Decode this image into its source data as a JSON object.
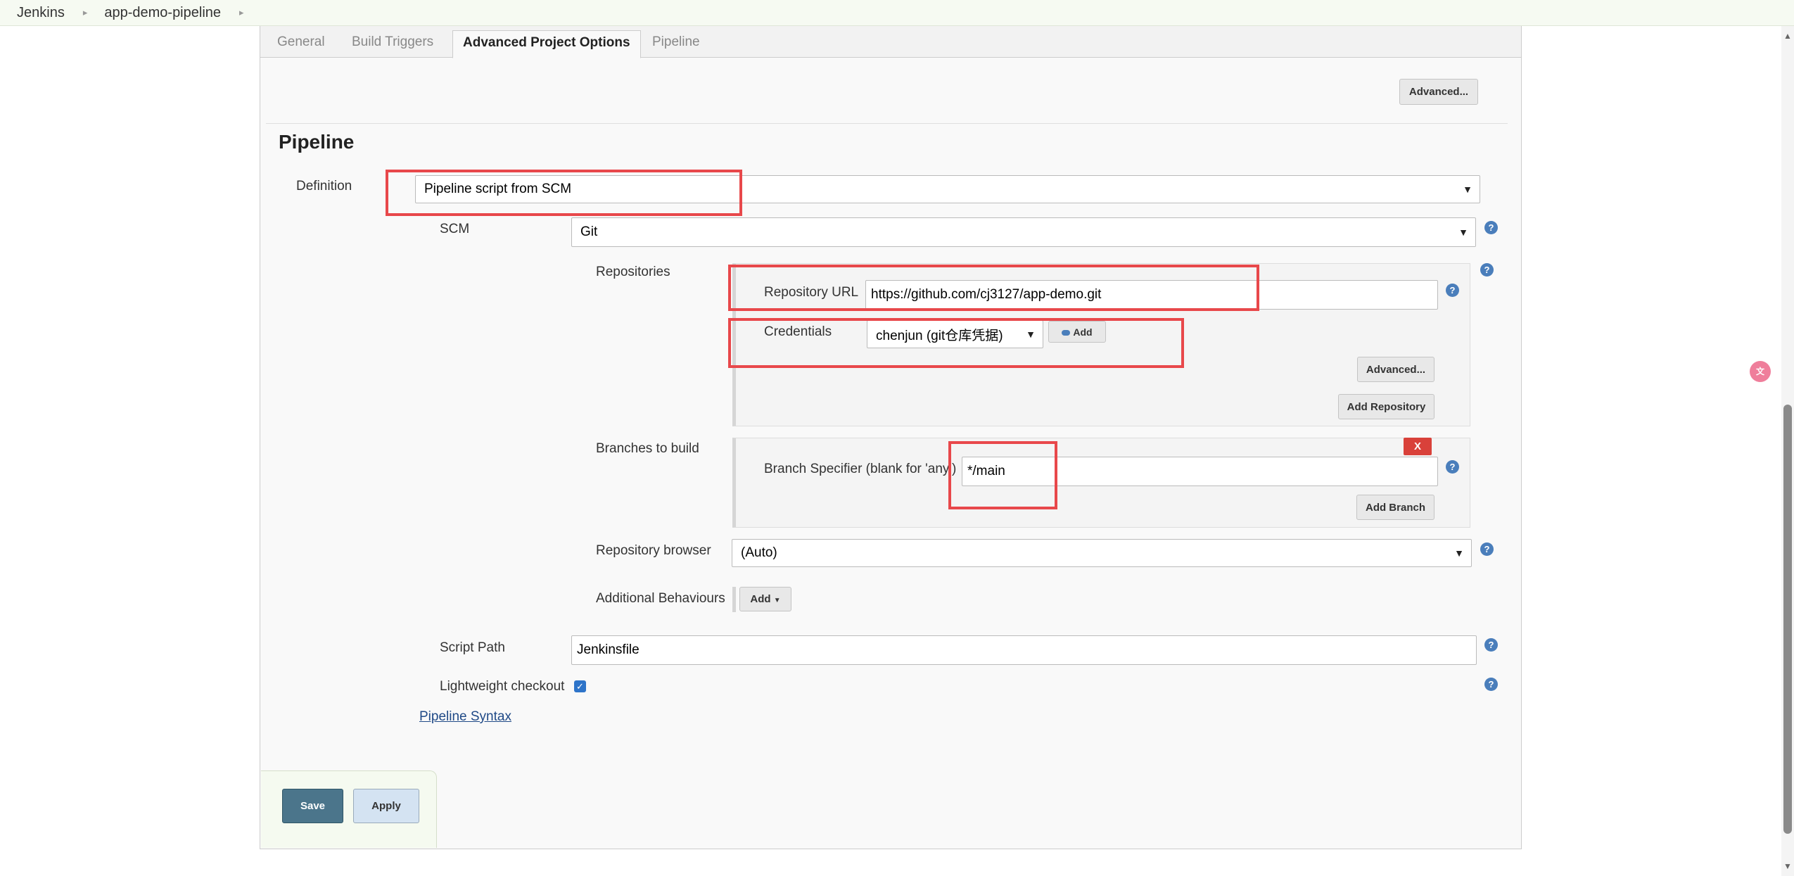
{
  "breadcrumb": {
    "items": [
      "Jenkins",
      "app-demo-pipeline"
    ],
    "separator": "▸"
  },
  "tabs": [
    {
      "label": "General"
    },
    {
      "label": "Build Triggers"
    },
    {
      "label": "Advanced Project Options"
    },
    {
      "label": "Pipeline"
    }
  ],
  "top_advanced_button": "Advanced...",
  "pipeline": {
    "title": "Pipeline",
    "definition_label": "Definition",
    "definition_value": "Pipeline script from SCM",
    "scm_label": "SCM",
    "scm_value": "Git",
    "repositories_label": "Repositories",
    "repository_url_label": "Repository URL",
    "repository_url_value": "https://github.com/cj3127/app-demo.git",
    "credentials_label": "Credentials",
    "credentials_value": "chenjun (git仓库凭据)",
    "credentials_add_button": "Add",
    "repo_advanced_button": "Advanced...",
    "add_repository_button": "Add Repository",
    "branches_label": "Branches to build",
    "branch_specifier_label": "Branch Specifier (blank for 'any')",
    "branch_specifier_value": "*/main",
    "delete_branch_button": "X",
    "add_branch_button": "Add Branch",
    "repo_browser_label": "Repository browser",
    "repo_browser_value": "(Auto)",
    "additional_behaviours_label": "Additional Behaviours",
    "additional_behaviours_add_button": "Add",
    "script_path_label": "Script Path",
    "script_path_value": "Jenkinsfile",
    "lightweight_checkout_label": "Lightweight checkout",
    "lightweight_checkout_checked": true,
    "pipeline_syntax_link": "Pipeline Syntax"
  },
  "actions": {
    "save": "Save",
    "apply": "Apply"
  },
  "colors": {
    "highlight_red": "#e8484b",
    "save_button": "#4b758b",
    "apply_button": "#d4e3f2",
    "help_icon": "#4a7ebb",
    "delete_button": "#d9413a"
  },
  "icons": [
    "help-icon",
    "chevron-down-icon",
    "credentials-key-icon",
    "translate-icon",
    "breadcrumb-chevron-icon"
  ]
}
